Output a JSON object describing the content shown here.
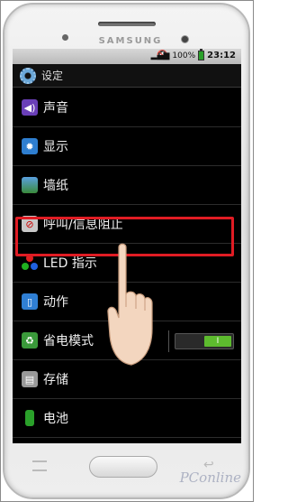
{
  "device": {
    "brand": "SAMSUNG"
  },
  "statusbar": {
    "battery": "100%",
    "time": "23:12"
  },
  "header": {
    "title": "设定"
  },
  "settings": {
    "items": [
      {
        "label": "声音",
        "icon": "speaker-icon"
      },
      {
        "label": "显示",
        "icon": "display-icon"
      },
      {
        "label": "墙纸",
        "icon": "wallpaper-icon"
      },
      {
        "label": "呼叫/信息阻止",
        "icon": "call-block-icon"
      },
      {
        "label": "LED 指示",
        "icon": "led-icon"
      },
      {
        "label": "动作",
        "icon": "motion-icon"
      },
      {
        "label": "省电模式",
        "icon": "power-saving-icon"
      },
      {
        "label": "存储",
        "icon": "storage-icon"
      },
      {
        "label": "电池",
        "icon": "battery-icon"
      }
    ],
    "power_saving_toggle": {
      "state": "on",
      "label": "I"
    }
  },
  "watermark": {
    "text": "PConline"
  },
  "colors": {
    "highlight": "#e01c24",
    "toggle_on": "#5dbb2e"
  }
}
